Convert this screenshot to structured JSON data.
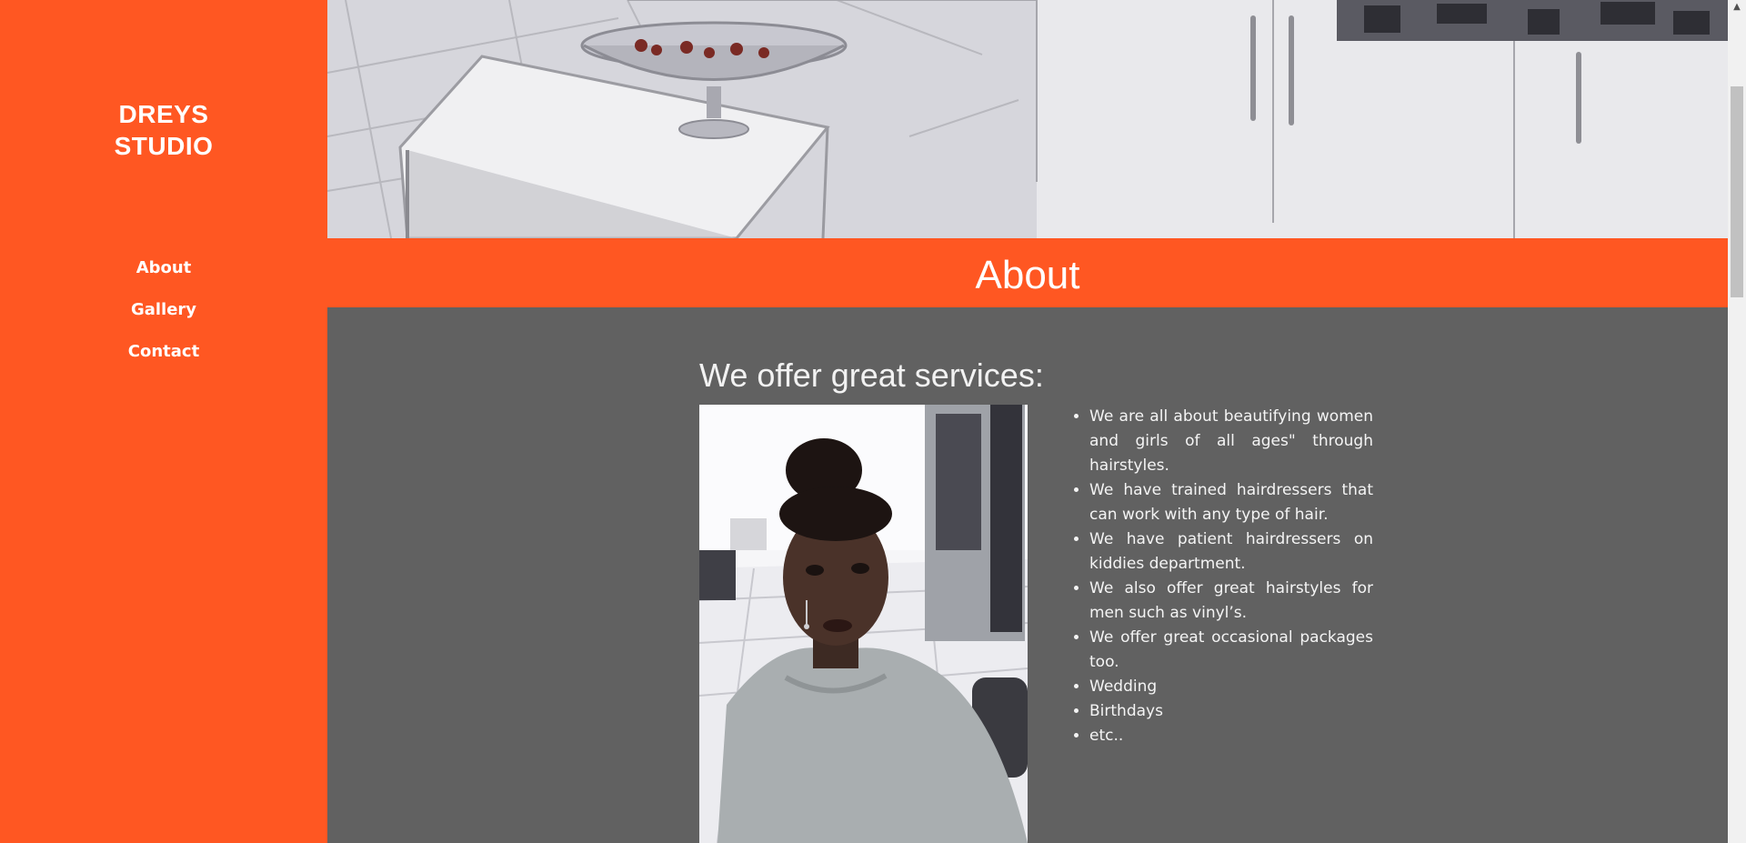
{
  "sidebar": {
    "brand_line1": "DREYS",
    "brand_line2": "STUDIO",
    "nav": [
      {
        "label": "About"
      },
      {
        "label": "Gallery"
      },
      {
        "label": "Contact"
      }
    ]
  },
  "about_banner": {
    "title": "About"
  },
  "services": {
    "heading": "We offer great services:",
    "items": [
      "We are all about beautifying women and girls of all ages\" through hairstyles.",
      "We have trained hairdressers that can work with any type of hair.",
      "We have patient hairdressers on kiddies department.",
      "We also offer great hairstyles for men such as vinyl’s.",
      "We offer great occasional packages too.",
      "Wedding",
      "Birthdays",
      "etc.."
    ]
  },
  "scrollbar": {
    "up_arrow_icon": "caret-up-icon"
  },
  "colors": {
    "accent": "#ff5722",
    "content_background": "#616161",
    "text_light": "#ffffff"
  },
  "images": {
    "hero": "salon-interior-photo",
    "profile": "stylist-portrait-photo"
  }
}
